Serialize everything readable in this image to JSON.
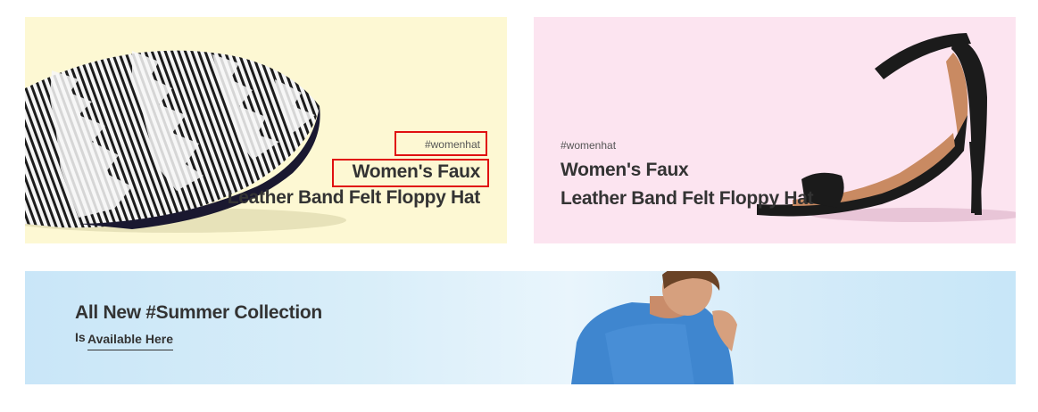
{
  "banners": [
    {
      "tag": "#womenhat",
      "title_line1": "Women's Faux",
      "title_line2": "Leather Band Felt Floppy Hat",
      "image_icon": "pillow-image",
      "background": "#fdf8d3"
    },
    {
      "tag": "#womenhat",
      "title_line1": "Women's Faux",
      "title_line2": "Leather Band Felt Floppy Hat",
      "image_icon": "sandal-image",
      "background": "#fce4f0"
    }
  ],
  "summer": {
    "title": "All New #Summer Collection",
    "prefix": "Is",
    "link_label": "Available Here",
    "image_icon": "model-image",
    "background": "#c9e6f8"
  },
  "highlight_color": "#e01010"
}
